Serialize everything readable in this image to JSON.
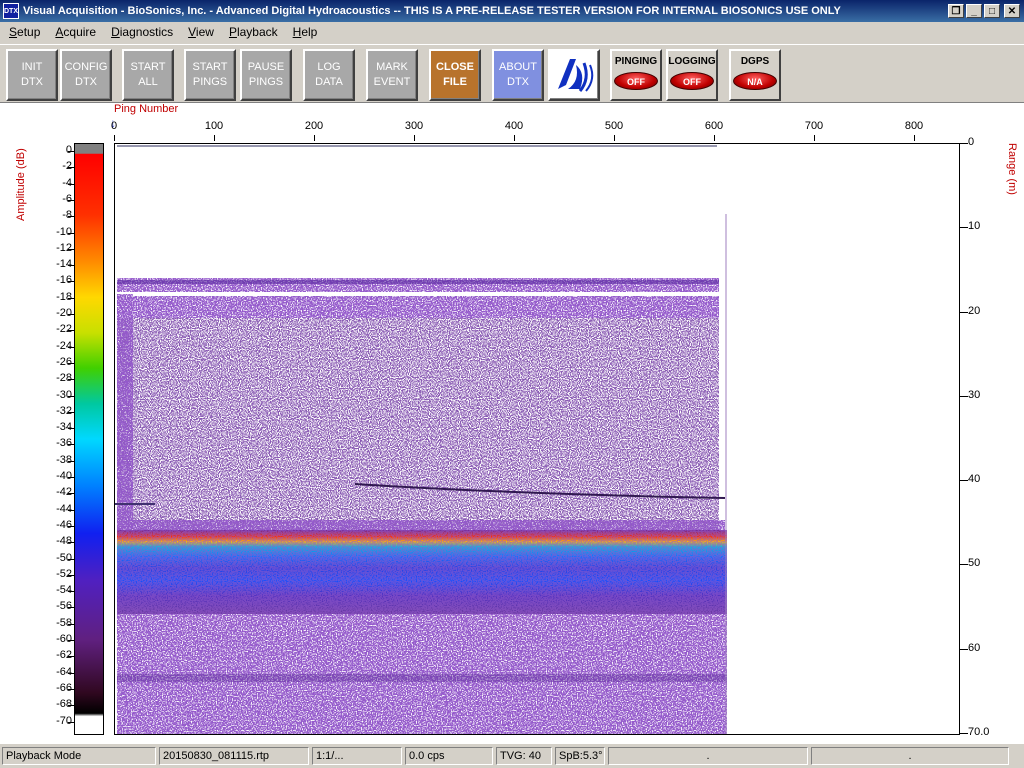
{
  "window": {
    "icon_text": "DTX",
    "title": "Visual Acquisition  -  BioSonics, Inc.  -  Advanced Digital Hydroacoustics  -- THIS IS A PRE-RELEASE TESTER VERSION FOR INTERNAL BIOSONICS USE ONLY",
    "restore_glyph": "❐",
    "minimize_glyph": "_",
    "maximize_glyph": "□",
    "close_glyph": "✕"
  },
  "menu": [
    "Setup",
    "Acquire",
    "Diagnostics",
    "View",
    "Playback",
    "Help"
  ],
  "toolbar": {
    "buttons": [
      {
        "line1": "INIT",
        "line2": "DTX"
      },
      {
        "line1": "CONFIG",
        "line2": "DTX"
      },
      {
        "line1": "START",
        "line2": "ALL"
      },
      {
        "line1": "START",
        "line2": "PINGS"
      },
      {
        "line1": "PAUSE",
        "line2": "PINGS"
      },
      {
        "line1": "LOG",
        "line2": "DATA"
      },
      {
        "line1": "MARK",
        "line2": "EVENT"
      },
      {
        "line1": "CLOSE",
        "line2": "FILE"
      },
      {
        "line1": "ABOUT",
        "line2": "DTX"
      }
    ],
    "logo_icon": "biosonics-logo-icon",
    "indicators": [
      {
        "label": "PINGING",
        "state": "OFF"
      },
      {
        "label": "LOGGING",
        "state": "OFF"
      },
      {
        "label": "DGPS",
        "state": "N/A"
      }
    ]
  },
  "echogram": {
    "ping_axis_label": "Ping Number",
    "amplitude_label": "Amplitude (dB)",
    "range_label": "Range (m)",
    "x_ticks": [
      "0",
      "100",
      "200",
      "300",
      "400",
      "500",
      "600",
      "700",
      "800"
    ],
    "y_ticks": [
      "0",
      "10",
      "20",
      "30",
      "40",
      "50",
      "60",
      "70.0"
    ],
    "colorbar_ticks": [
      "0",
      "-2",
      "-4",
      "-6",
      "-8",
      "-10",
      "-12",
      "-14",
      "-16",
      "-18",
      "-20",
      "-22",
      "-24",
      "-26",
      "-28",
      "-30",
      "-32",
      "-34",
      "-36",
      "-38",
      "-40",
      "-42",
      "-44",
      "-46",
      "-48",
      "-50",
      "-52",
      "-54",
      "-56",
      "-58",
      "-60",
      "-62",
      "-64",
      "-66",
      "-68",
      "-70"
    ],
    "ping_marker": "↓"
  },
  "colors": {
    "title_bar": "#0a246a",
    "label_red": "#c00000",
    "close_file_button": "#b8732c",
    "about_button": "#8090e0"
  },
  "status": {
    "mode": "Playback Mode",
    "file": "20150830_081115.rtp",
    "ratio": "1:1/...",
    "cps": "0.0 cps",
    "tvg": "TVG: 40",
    "spb": "SpB:5.3°",
    "blank1": ".",
    "blank2": "."
  }
}
